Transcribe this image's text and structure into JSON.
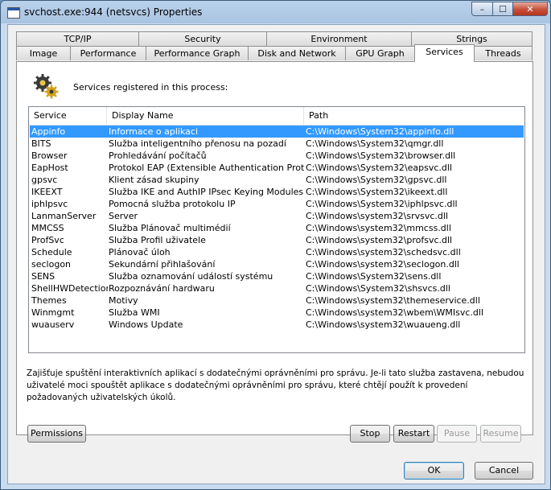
{
  "window": {
    "title": "svchost.exe:944 (netsvcs) Properties",
    "controls": {
      "minimize": "–",
      "maximize": "☐",
      "close": "✕"
    }
  },
  "tabs_back": [
    "TCP/IP",
    "Security",
    "Environment",
    "Strings"
  ],
  "tabs_front": [
    "Image",
    "Performance",
    "Performance Graph",
    "Disk and Network",
    "GPU Graph",
    "Services",
    "Threads"
  ],
  "active_tab": "Services",
  "services_label": "Services registered in this process:",
  "columns": [
    "Service",
    "Display Name",
    "Path"
  ],
  "services": [
    {
      "service": "Appinfo",
      "display_name": "Informace o aplikaci",
      "path": "C:\\Windows\\System32\\appinfo.dll",
      "selected": true
    },
    {
      "service": "BITS",
      "display_name": "Služba inteligentního přenosu na pozadí",
      "path": "C:\\Windows\\System32\\qmgr.dll"
    },
    {
      "service": "Browser",
      "display_name": "Prohledávání počítačů",
      "path": "C:\\Windows\\System32\\browser.dll"
    },
    {
      "service": "EapHost",
      "display_name": "Protokol EAP (Extensible Authentication Protocol)",
      "path": "C:\\Windows\\System32\\eapsvc.dll"
    },
    {
      "service": "gpsvc",
      "display_name": "Klient zásad skupiny",
      "path": "C:\\Windows\\System32\\gpsvc.dll"
    },
    {
      "service": "IKEEXT",
      "display_name": "Služba IKE and AuthIP IPsec Keying Modules",
      "path": "C:\\Windows\\System32\\ikeext.dll"
    },
    {
      "service": "iphlpsvc",
      "display_name": "Pomocná služba protokolu IP",
      "path": "C:\\Windows\\System32\\iphlpsvc.dll"
    },
    {
      "service": "LanmanServer",
      "display_name": "Server",
      "path": "C:\\Windows\\system32\\srvsvc.dll"
    },
    {
      "service": "MMCSS",
      "display_name": "Služba Plánovač multimédií",
      "path": "C:\\Windows\\system32\\mmcss.dll"
    },
    {
      "service": "ProfSvc",
      "display_name": "Služba Profil uživatele",
      "path": "C:\\Windows\\system32\\profsvc.dll"
    },
    {
      "service": "Schedule",
      "display_name": "Plánovač úloh",
      "path": "C:\\Windows\\system32\\schedsvc.dll"
    },
    {
      "service": "seclogon",
      "display_name": "Sekundární přihlašování",
      "path": "C:\\Windows\\system32\\seclogon.dll"
    },
    {
      "service": "SENS",
      "display_name": "Služba oznamování událostí systému",
      "path": "C:\\Windows\\System32\\sens.dll"
    },
    {
      "service": "ShellHWDetection",
      "display_name": "Rozpoznávání hardwaru",
      "path": "C:\\Windows\\System32\\shsvcs.dll"
    },
    {
      "service": "Themes",
      "display_name": "Motivy",
      "path": "C:\\Windows\\system32\\themeservice.dll"
    },
    {
      "service": "Winmgmt",
      "display_name": "Služba WMI",
      "path": "C:\\Windows\\system32\\wbem\\WMIsvc.dll"
    },
    {
      "service": "wuauserv",
      "display_name": "Windows Update",
      "path": "C:\\Windows\\system32\\wuaueng.dll"
    }
  ],
  "description": "Zajišťuje spuštění interaktivních aplikací s dodatečnými oprávněními pro správu. Je-li tato služba zastavena, nebudou uživatelé moci spouštět aplikace s dodatečnými oprávněními pro správu, které chtějí použít k provedení požadovaných uživatelských úkolů.",
  "buttons": {
    "permissions": "Permissions",
    "stop": "Stop",
    "restart": "Restart",
    "pause": "Pause",
    "resume": "Resume",
    "ok": "OK",
    "cancel": "Cancel"
  }
}
